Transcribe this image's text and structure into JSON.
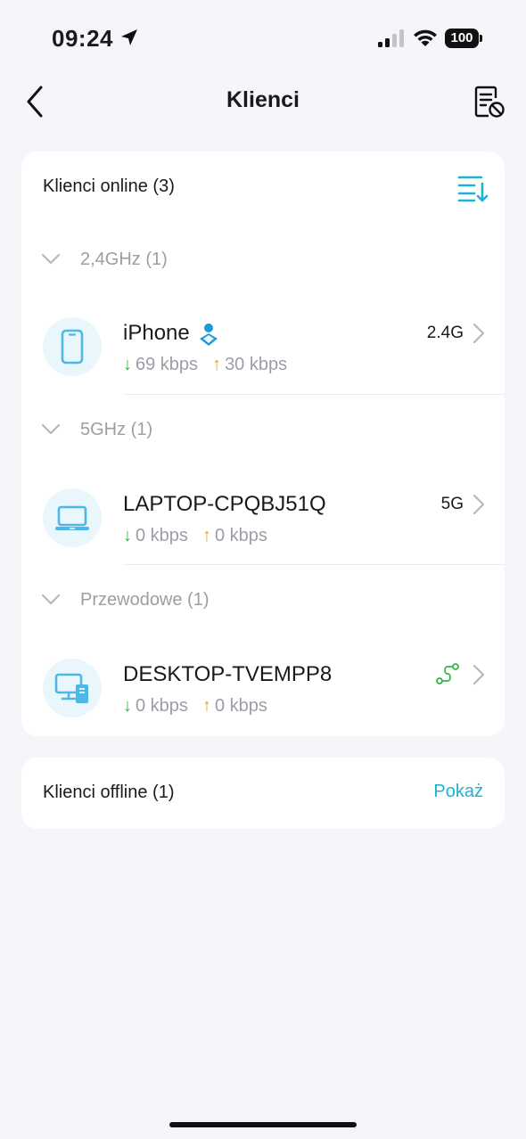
{
  "status_bar": {
    "time": "09:24",
    "battery": "100"
  },
  "nav": {
    "title": "Klienci"
  },
  "online": {
    "title": "Klienci online (3)",
    "groups": [
      {
        "label": "2,4GHz (1)",
        "client": {
          "name": "iPhone",
          "down": "69 kbps",
          "up": "30 kbps",
          "band": "2.4G",
          "icon": "phone-icon"
        }
      },
      {
        "label": "5GHz (1)",
        "client": {
          "name": "LAPTOP-CPQBJ51Q",
          "down": "0 kbps",
          "up": "0 kbps",
          "band": "5G",
          "icon": "laptop-icon"
        }
      },
      {
        "label": "Przewodowe (1)",
        "client": {
          "name": "DESKTOP-TVEMPP8",
          "down": "0 kbps",
          "up": "0 kbps",
          "band": "",
          "icon": "desktop-icon"
        }
      }
    ]
  },
  "offline": {
    "title": "Klienci offline (1)",
    "action": "Pokaż"
  },
  "colors": {
    "accent": "#1ab4d4",
    "download": "#36b54a",
    "upload": "#f0a12b",
    "muted": "#9a9ea6"
  }
}
